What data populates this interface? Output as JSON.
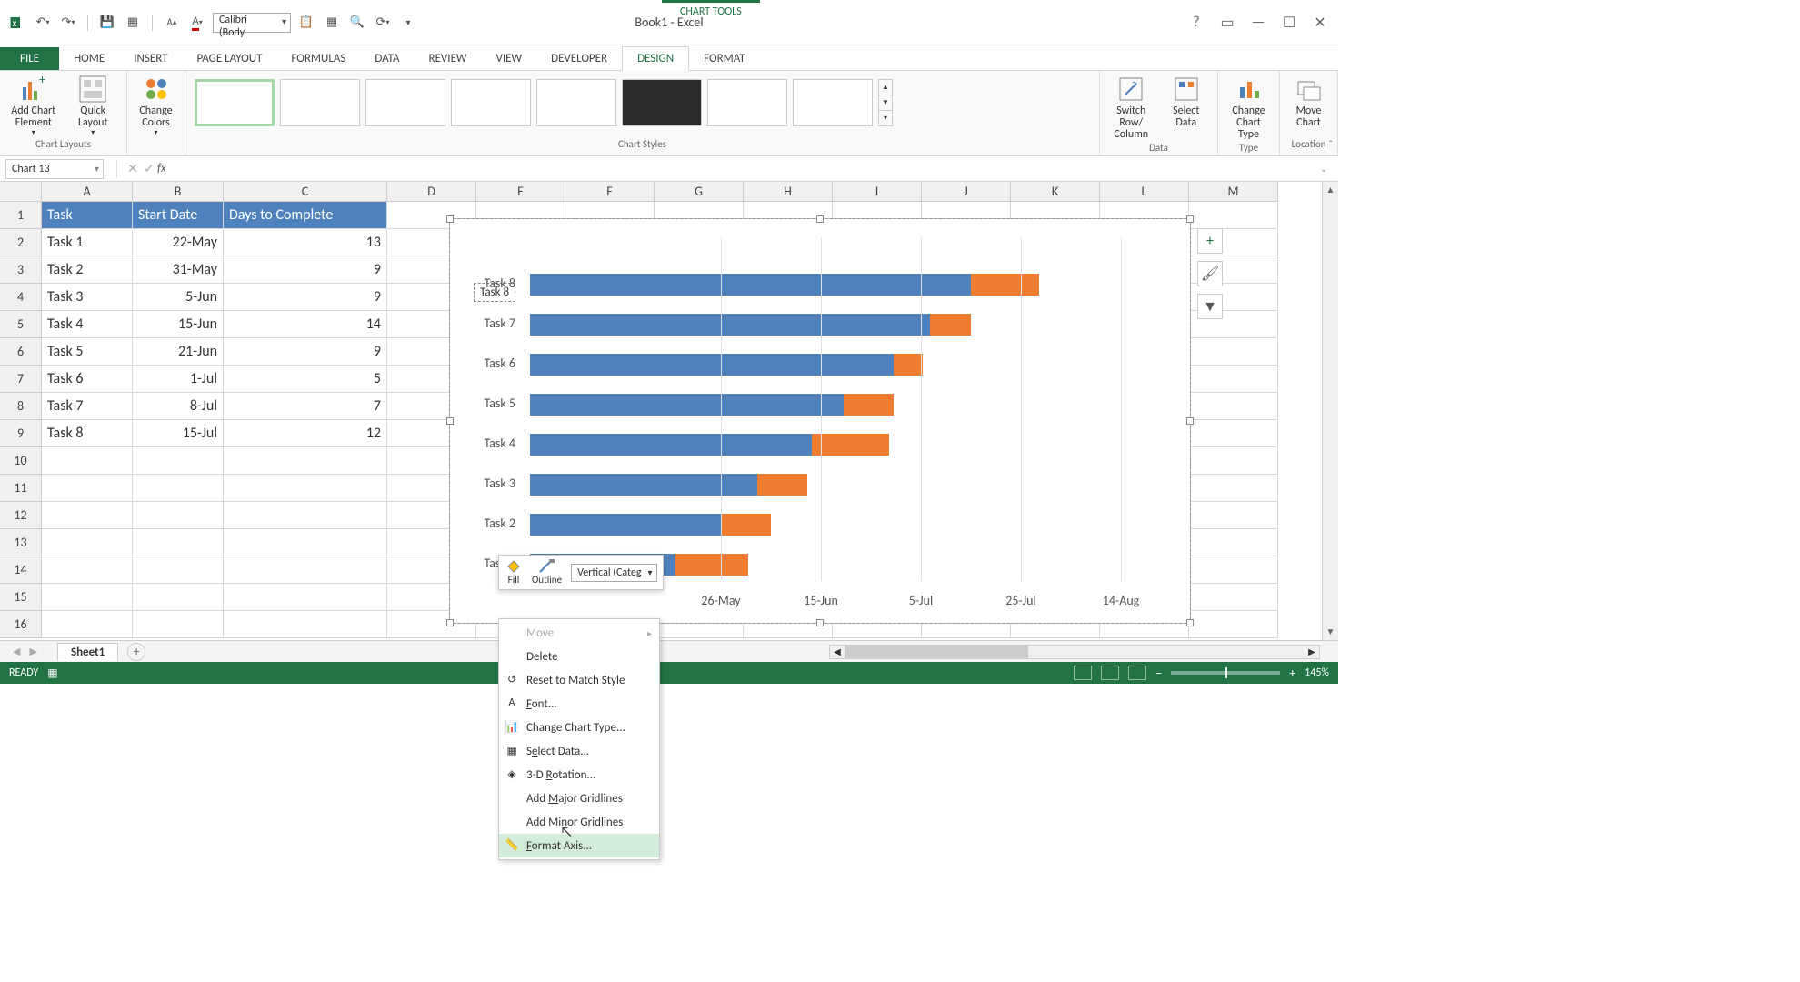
{
  "app": {
    "title": "Book1 - Excel",
    "chart_tools": "CHART TOOLS"
  },
  "qat": {
    "font_selected": "Calibri (Body"
  },
  "tabs": {
    "file": "FILE",
    "home": "HOME",
    "insert": "INSERT",
    "pagelayout": "PAGE LAYOUT",
    "formulas": "FORMULAS",
    "data": "DATA",
    "review": "REVIEW",
    "view": "VIEW",
    "developer": "DEVELOPER",
    "design": "DESIGN",
    "format": "FORMAT"
  },
  "ribbon": {
    "add_chart_element": "Add Chart Element",
    "quick_layout": "Quick Layout",
    "change_colors": "Change Colors",
    "switch_rowcol": "Switch Row/ Column",
    "select_data": "Select Data",
    "change_chart_type": "Change Chart Type",
    "move_chart": "Move Chart",
    "grp_chart_layouts": "Chart Layouts",
    "grp_chart_styles": "Chart Styles",
    "grp_data": "Data",
    "grp_type": "Type",
    "grp_location": "Location"
  },
  "name_box": "Chart 13",
  "columns": [
    "A",
    "B",
    "C",
    "D",
    "E",
    "F",
    "G",
    "H",
    "I",
    "J",
    "K",
    "L",
    "M"
  ],
  "row_numbers": [
    "1",
    "2",
    "3",
    "4",
    "5",
    "6",
    "7",
    "8",
    "9",
    "10",
    "11",
    "12",
    "13",
    "14",
    "15",
    "16"
  ],
  "table": {
    "headers": {
      "task": "Task",
      "start": "Start Date",
      "days": "Days to Complete"
    },
    "rows": [
      {
        "task": "Task 1",
        "start": "22-May",
        "days": "13"
      },
      {
        "task": "Task 2",
        "start": "31-May",
        "days": "9"
      },
      {
        "task": "Task 3",
        "start": "5-Jun",
        "days": "9"
      },
      {
        "task": "Task 4",
        "start": "15-Jun",
        "days": "14"
      },
      {
        "task": "Task 5",
        "start": "21-Jun",
        "days": "9"
      },
      {
        "task": "Task 6",
        "start": "1-Jul",
        "days": "5"
      },
      {
        "task": "Task 7",
        "start": "8-Jul",
        "days": "7"
      },
      {
        "task": "Task 8",
        "start": "15-Jul",
        "days": "12"
      }
    ]
  },
  "chart_data": {
    "type": "bar",
    "orientation": "horizontal",
    "categories": [
      "Task 8",
      "Task 7",
      "Task 6",
      "Task 5",
      "Task 4",
      "Task 3",
      "Task 2",
      "Task 1"
    ],
    "x_ticks": [
      "26-May",
      "15-Jun",
      "5-Jul",
      "25-Jul",
      "14-Aug"
    ],
    "series": [
      {
        "name": "Start Date",
        "color": "#4f81bd",
        "values": [
          "15-Jul",
          "8-Jul",
          "1-Jul",
          "21-Jun",
          "15-Jun",
          "5-Jun",
          "31-May",
          "22-May"
        ]
      },
      {
        "name": "Days to Complete",
        "color": "#ed7d31",
        "values": [
          12,
          7,
          5,
          9,
          14,
          9,
          9,
          13
        ]
      }
    ]
  },
  "mini_toolbar": {
    "fill": "Fill",
    "outline": "Outline",
    "combo": "Vertical (Categ"
  },
  "context_menu": {
    "move": "Move",
    "delete": "Delete",
    "reset": "Reset to Match Style",
    "font": "Font...",
    "change_chart_type": "Change Chart Type...",
    "select_data": "Select Data...",
    "rotation3d": "3-D Rotation...",
    "add_major": "Add Major Gridlines",
    "add_minor": "Add Minor Gridlines",
    "format_axis": "Format Axis..."
  },
  "sheet": {
    "name": "Sheet1"
  },
  "status": {
    "ready": "READY",
    "zoom": "145%"
  }
}
